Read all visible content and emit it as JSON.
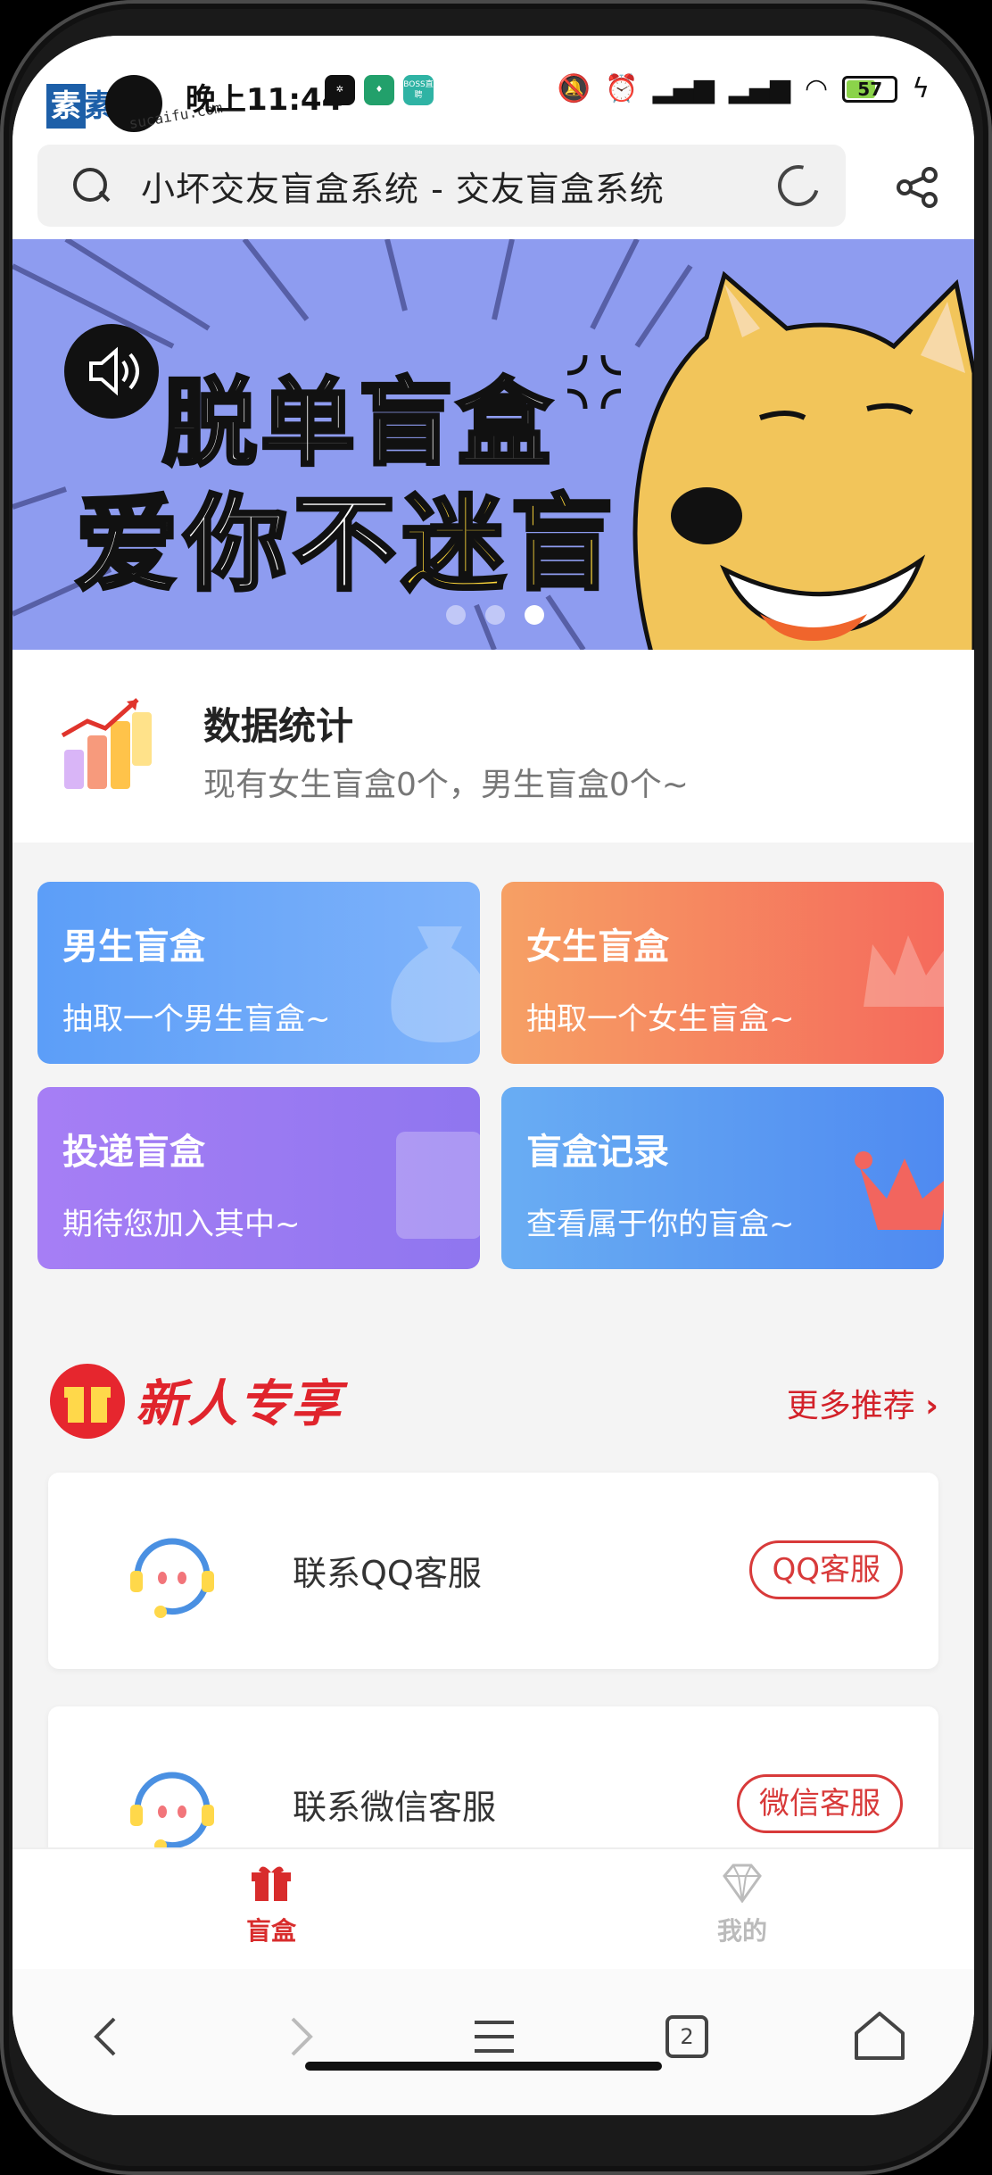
{
  "status_bar": {
    "time": "晚上11:44",
    "watermark_text": "素材",
    "watermark_small": "sucaifu.com",
    "battery": "57",
    "app_icon_boss": "BOSS直聘"
  },
  "address_bar": {
    "url_title": "小坏交友盲盒系统 - 交友盲盒系统"
  },
  "banner": {
    "line1": "脱单盲盒",
    "line2_prefix": "爱你不",
    "line2_highlight": "迷盲",
    "slides": 3,
    "active_slide": 3
  },
  "stats": {
    "title": "数据统计",
    "description": "现有女生盲盒0个，男生盲盒0个~"
  },
  "cards": [
    {
      "title": "男生盲盒",
      "subtitle": "抽取一个男生盲盒~"
    },
    {
      "title": "女生盲盒",
      "subtitle": "抽取一个女生盲盒~"
    },
    {
      "title": "投递盲盒",
      "subtitle": "期待您加入其中~"
    },
    {
      "title": "盲盒记录",
      "subtitle": "查看属于你的盲盒~"
    }
  ],
  "section": {
    "title": "新人专享",
    "more": "更多推荐"
  },
  "services": [
    {
      "label": "联系QQ客服",
      "button": "QQ客服"
    },
    {
      "label": "联系微信客服",
      "button": "微信客服"
    }
  ],
  "tabbar": {
    "home": "盲盒",
    "mine": "我的"
  },
  "browser_nav": {
    "tab_count": "2"
  },
  "colors": {
    "accent_red": "#d82c2c",
    "banner_bg": "#8e9cf0",
    "male_card": "#5c9ef8",
    "female_card": "#f56a5c",
    "drop_card": "#a67ef5",
    "record_card": "#4f8af1"
  }
}
